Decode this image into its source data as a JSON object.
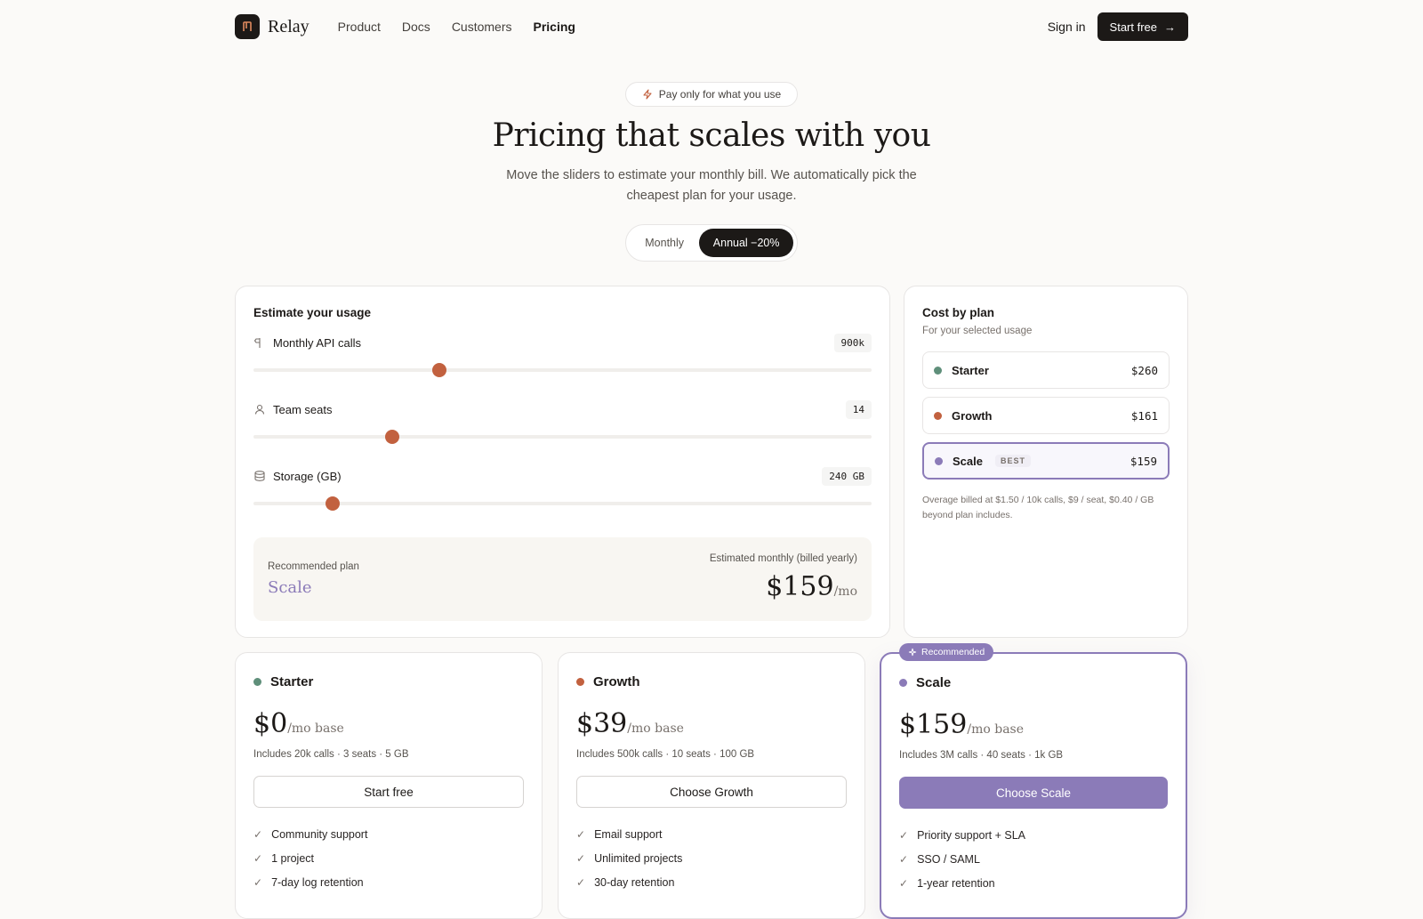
{
  "brand": {
    "name": "Relay"
  },
  "nav": {
    "links": [
      "Product",
      "Docs",
      "Customers",
      "Pricing"
    ],
    "signin": "Sign in",
    "cta": "Start free"
  },
  "hero": {
    "pill": "Pay only for what you use",
    "title": "Pricing that scales with you",
    "subtitle": "Move the sliders to estimate your monthly bill. We automatically pick the cheapest plan for your usage."
  },
  "billing_toggle": {
    "monthly": "Monthly",
    "annual": "Annual −20%",
    "selected": "annual"
  },
  "estimator": {
    "title": "Estimate your usage",
    "sliders": [
      {
        "label": "Monthly API calls",
        "value": "900k",
        "level": 0.3,
        "icon": "signpost-icon"
      },
      {
        "label": "Team seats",
        "value": "14",
        "level": 0.225,
        "icon": "user-icon"
      },
      {
        "label": "Storage (GB)",
        "value": "240 GB",
        "level": 0.128,
        "icon": "database-icon"
      }
    ],
    "recommended_label": "Recommended plan",
    "recommended_plan": "Scale",
    "estimate_label": "Estimated monthly (billed yearly)",
    "estimate_price": "$159",
    "estimate_unit": "/mo"
  },
  "cost_by_plan": {
    "title": "Cost by plan",
    "subtitle": "For your selected usage",
    "plans": [
      {
        "name": "Starter",
        "price": "$260",
        "color": "#5f8f7a"
      },
      {
        "name": "Growth",
        "price": "$161",
        "color": "#c2613f"
      },
      {
        "name": "Scale",
        "price": "$159",
        "color": "#8b7bb8",
        "tag": "BEST"
      }
    ],
    "note": "Overage billed at $1.50 / 10k calls, $9 / seat, $0.40 / GB beyond plan includes."
  },
  "tiers": [
    {
      "name": "Starter",
      "price": "$0",
      "unit": "/mo base",
      "includes": "Includes 20k calls · 3 seats · 5 GB",
      "button": "Start free",
      "color": "#5f8f7a",
      "features": [
        "Community support",
        "1 project",
        "7-day log retention"
      ]
    },
    {
      "name": "Growth",
      "price": "$39",
      "unit": "/mo base",
      "includes": "Includes 500k calls · 10 seats · 100 GB",
      "button": "Choose Growth",
      "color": "#c2613f",
      "features": [
        "Email support",
        "Unlimited projects",
        "30-day retention"
      ]
    },
    {
      "name": "Scale",
      "price": "$159",
      "unit": "/mo base",
      "includes": "Includes 3M calls · 40 seats · 1k GB",
      "button": "Choose Scale",
      "color": "#8b7bb8",
      "badge": "Recommended",
      "features": [
        "Priority support + SLA",
        "SSO / SAML",
        "1-year retention"
      ]
    }
  ]
}
